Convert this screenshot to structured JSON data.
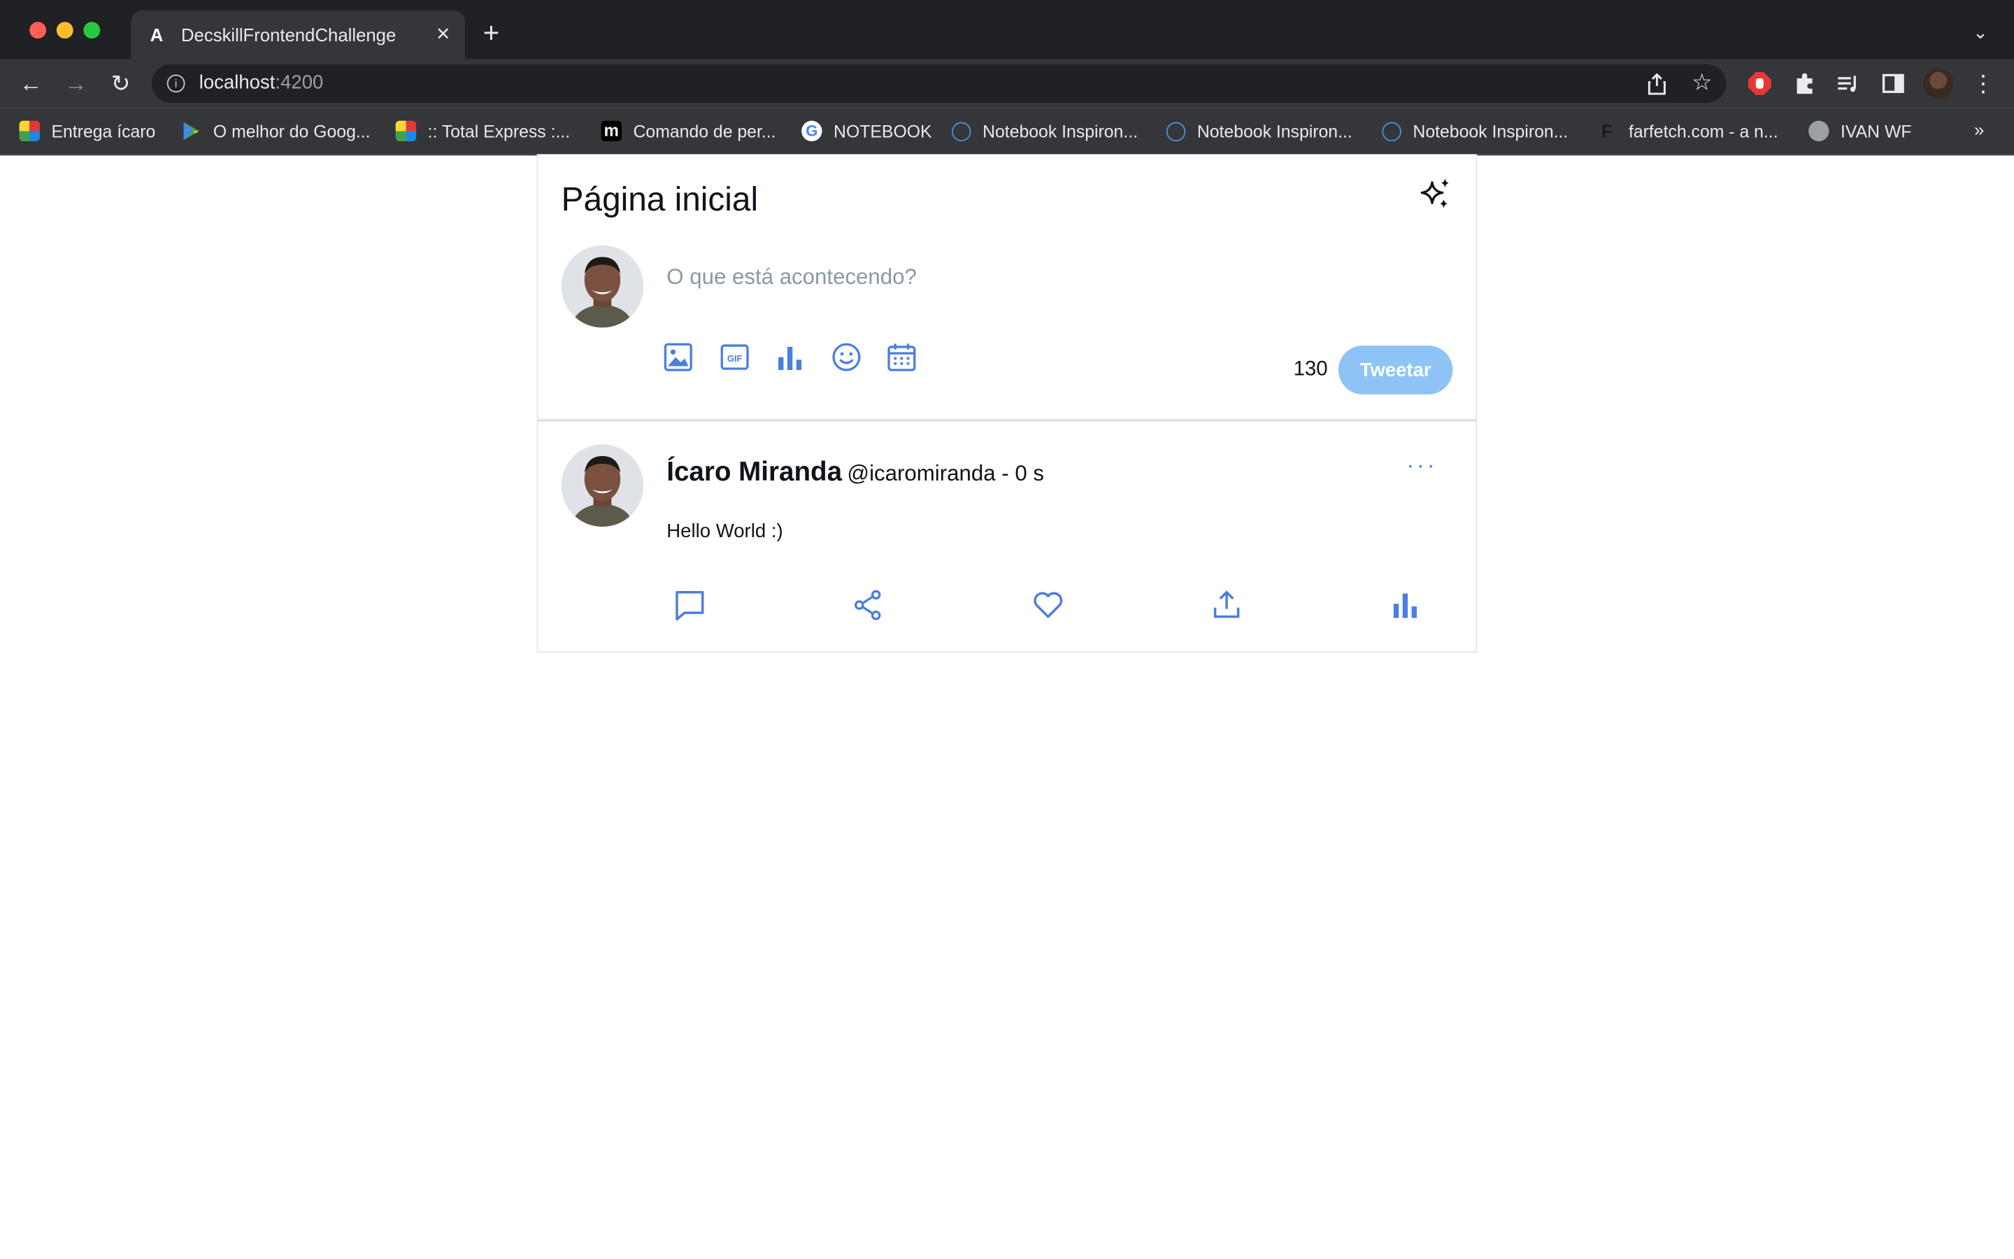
{
  "browser": {
    "tab_title": "DecskillFrontendChallenge",
    "url_host": "localhost",
    "url_port": ":4200",
    "bookmarks": [
      {
        "label": "Entrega ícaro",
        "icon": "colorful-logo-icon"
      },
      {
        "label": "O melhor do Goog...",
        "icon": "google-play-icon"
      },
      {
        "label": ":: Total Express :...",
        "icon": "colorful-logo-icon"
      },
      {
        "label": "Comando de per...",
        "icon": "medium-icon"
      },
      {
        "label": "NOTEBOOK",
        "icon": "google-icon"
      },
      {
        "label": "Notebook Inspiron...",
        "icon": "dell-icon"
      },
      {
        "label": "Notebook Inspiron...",
        "icon": "dell-icon"
      },
      {
        "label": "Notebook Inspiron...",
        "icon": "dell-icon"
      },
      {
        "label": "farfetch.com - a n...",
        "icon": "farfetch-icon"
      },
      {
        "label": "IVAN WF",
        "icon": "globe-icon"
      }
    ],
    "more_bookmarks": "»"
  },
  "home": {
    "title": "Página inicial",
    "compose_placeholder": "O que está acontecendo?",
    "char_count": "130",
    "tweet_button": "Tweetar",
    "tools": [
      "image-icon",
      "gif-icon",
      "poll-icon",
      "emoji-icon",
      "schedule-icon"
    ]
  },
  "tweet": {
    "author": "Ícaro Miranda",
    "meta": "@icaromiranda - 0 s",
    "text": "Hello World :)",
    "more": "···",
    "actions": [
      "reply-icon",
      "share-icon",
      "like-icon",
      "upload-icon",
      "analytics-icon"
    ]
  },
  "colors": {
    "accent": "#4a7ee0",
    "tweet_button_bg": "#8ec3f5",
    "chrome_dark": "#202124",
    "chrome_toolbar": "#35363a"
  }
}
